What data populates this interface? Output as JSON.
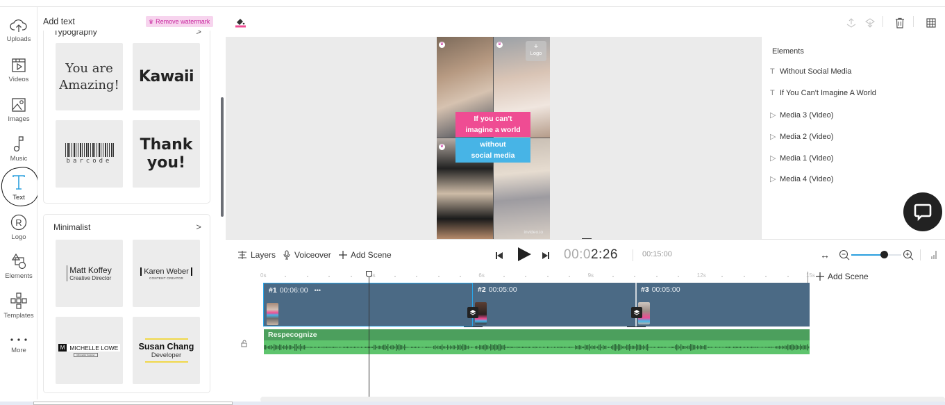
{
  "left_rail": {
    "items": [
      {
        "label": "Uploads",
        "icon": "cloud-upload-icon"
      },
      {
        "label": "Videos",
        "icon": "video-icon"
      },
      {
        "label": "Images",
        "icon": "image-icon"
      },
      {
        "label": "Music",
        "icon": "music-note-icon"
      },
      {
        "label": "Text",
        "icon": "text-t-icon",
        "active": true
      },
      {
        "label": "Logo",
        "icon": "registered-icon"
      },
      {
        "label": "Elements",
        "icon": "shapes-icon"
      },
      {
        "label": "Templates",
        "icon": "templates-grid-icon"
      },
      {
        "label": "More",
        "icon": "more-dots-icon"
      }
    ]
  },
  "text_panel": {
    "title": "Add text",
    "remove_watermark_label": "Remove watermark",
    "sections": [
      {
        "title": "Typography",
        "chevron": ">",
        "presets": [
          "You are Amazing!",
          "Kawaii",
          "barcode",
          "Thank you!"
        ]
      },
      {
        "title": "Minimalist",
        "chevron": ">",
        "presets": [
          {
            "name": "Matt Koffey",
            "sub": "Creative Director"
          },
          {
            "name": "Karen Weber",
            "sub": "CONTENT CREATOR"
          },
          {
            "name": "MICHELLE LOWE",
            "sub": "Minimalist Youtuber",
            "badge": "M"
          },
          {
            "name": "Susan Chang",
            "sub": "Developer"
          }
        ]
      }
    ]
  },
  "preview": {
    "caption_line1": "If you can't imagine a world",
    "caption_line1a": "If you can't",
    "caption_line1b": "imagine a world",
    "caption_line2a": "without",
    "caption_line2b": "social media",
    "logo_placeholder_plus": "+",
    "logo_placeholder_label": "Logo",
    "watermark": "invideo.io",
    "accent_pink": "#ef4c93",
    "accent_blue": "#47b4e6"
  },
  "elements_panel": {
    "title": "Elements",
    "items": [
      {
        "type": "text",
        "label": "Without Social Media"
      },
      {
        "type": "text",
        "label": "If You Can't Imagine A World"
      },
      {
        "type": "video",
        "label": "Media 3 (Video)"
      },
      {
        "type": "video",
        "label": "Media 2 (Video)"
      },
      {
        "type": "video",
        "label": "Media 1 (Video)"
      },
      {
        "type": "video",
        "label": "Media 4 (Video)"
      }
    ]
  },
  "timeline": {
    "layers_label": "Layers",
    "voiceover_label": "Voiceover",
    "add_scene_label": "Add Scene",
    "current_time_dim": "00:0",
    "current_time_bright": "2:26",
    "total_time": "00:15:00",
    "zoom_level": 0.65,
    "ruler_labels": [
      "0s",
      "3s",
      "6s",
      "9s",
      "12s",
      "15s"
    ],
    "playhead_seconds": 2.9,
    "scenes": [
      {
        "number": "#1",
        "duration": "00:06:00",
        "more": "•••",
        "selected": true
      },
      {
        "number": "#2",
        "duration": "00:05:00"
      },
      {
        "number": "#3",
        "duration": "00:05:00"
      }
    ],
    "end_add_scene_label": "Add Scene",
    "audio_track": {
      "name": "Respecognize"
    }
  }
}
